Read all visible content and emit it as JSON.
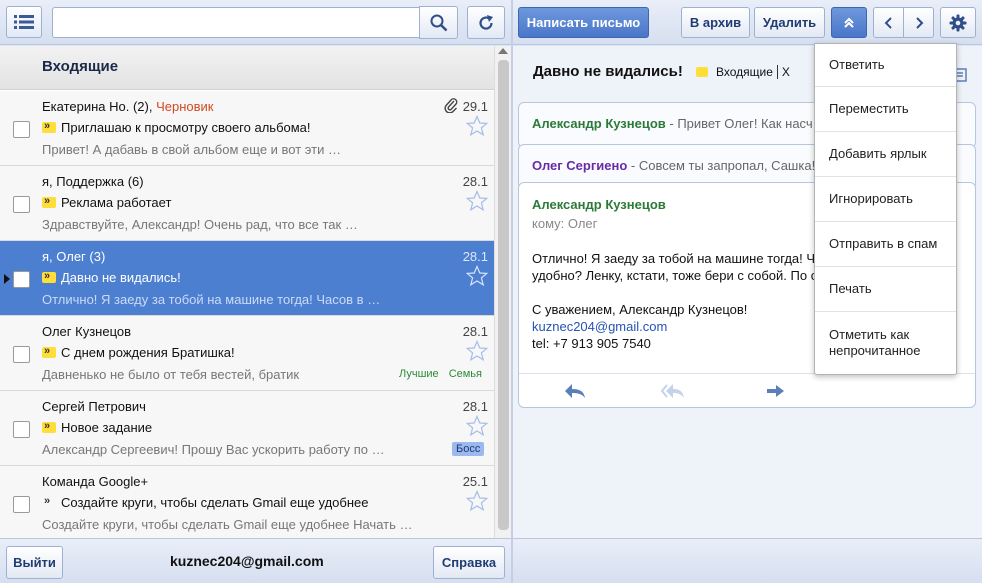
{
  "toolbar": {
    "search_value": "",
    "compose_label": "Написать письмо",
    "archive_label": "В архив",
    "delete_label": "Удалить"
  },
  "list": {
    "folder_title": "Входящие",
    "rows": [
      {
        "from": "Екатерина Но. (2), ",
        "draft": "Черновик",
        "date": "29.1",
        "subject": "Приглашаю к просмотру своего альбома!",
        "preview": "Привет! А дабавь в свой альбом еще и вот эти …",
        "has_attachment": true,
        "selected": false
      },
      {
        "from": "я, Поддержка (6)",
        "date": "28.1",
        "subject": "Реклама работает",
        "preview": "Здравствуйте, Александр! Очень рад, что все так …",
        "selected": false
      },
      {
        "from": "я, Олег (3)",
        "date": "28.1",
        "subject": "Давно не видались!",
        "preview": "Отлично! Я заеду за тобой на машине тогда! Часов в …",
        "selected": true
      },
      {
        "from": "Олег Кузнецов",
        "date": "28.1",
        "subject": "С днем рождения Братишка!",
        "preview": "Давненько не было от тебя вестей, братик",
        "labels": [
          "Лучшие",
          "Семья"
        ],
        "selected": false
      },
      {
        "from": "Сергей Петрович",
        "date": "28.1",
        "subject": "Новое задание",
        "preview": "Александр Сергеевич! Прошу Вас ускорить работу по …",
        "boss_label": "Босс",
        "selected": false
      },
      {
        "from": "Команда Google+",
        "date": "25.1",
        "subject": "Создайте круги, чтобы сделать Gmail еще удобнее",
        "preview": "Создайте круги, чтобы сделать Gmail еще удобнее Начать …",
        "selected": false
      }
    ]
  },
  "footer": {
    "logout_label": "Выйти",
    "account_email": "kuznec204@gmail.com",
    "help_label": "Справка"
  },
  "reading": {
    "thread_title": "Давно не видались!",
    "thread_label": "Входящие",
    "thread_label_close": "X",
    "collapsed": [
      {
        "sender": "Александр Кузнецов",
        "snippet": " - Привет Олег! Как насч"
      },
      {
        "sender": "Олег Сергиено",
        "snippet": " - Совсем ты запропал, Сашка!"
      }
    ],
    "open": {
      "sender": "Александр Кузнецов",
      "to": "кому: Олег",
      "line1": "Отлично! Я заеду за тобой на машине тогда! Ча",
      "line2": "удобно? Ленку, кстати, тоже бери с собой. По с",
      "sign": "С уважением, Александр Кузнецов!",
      "email": "kuznec204@gmail.com",
      "tel": "tel: +7 913 905 7540"
    }
  },
  "dropdown": {
    "items": [
      "Ответить",
      "Переместить",
      "Добавить ярлык",
      "Игнорировать",
      "Отправить в спам",
      "Печать",
      "Отметить как непрочитанное"
    ]
  },
  "colors": {
    "accent": "#4d7fd1",
    "draft": "#d14a1f",
    "label_yellow": "#ffde3a",
    "sender_green": "#2c7a38",
    "sender_purple": "#6a2aa8"
  }
}
